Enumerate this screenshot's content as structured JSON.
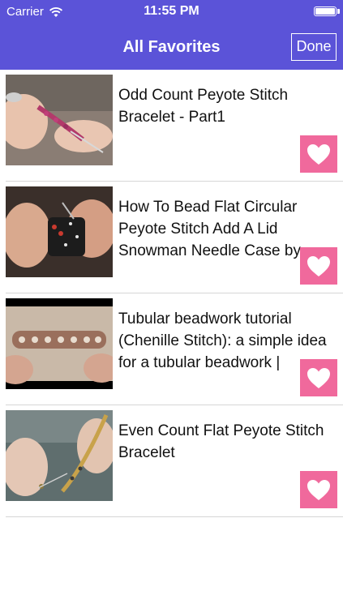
{
  "status_bar": {
    "carrier": "Carrier",
    "time": "11:55 PM"
  },
  "nav": {
    "title": "All Favorites",
    "done_label": "Done"
  },
  "items": [
    {
      "title": "Odd Count Peyote Stitch Bracelet - Part1"
    },
    {
      "title": "How To Bead Flat Circular Peyote Stitch Add A Lid Snowman Needle Case by Beth..."
    },
    {
      "title": "Tubular beadwork tutorial (Chenille Stitch): a simple idea for a tubular beadwork | Beadi..."
    },
    {
      "title": "Even Count Flat Peyote Stitch Bracelet"
    }
  ],
  "icons": {
    "favorite": "heart-icon",
    "wifi": "wifi-icon",
    "battery": "battery-icon"
  },
  "colors": {
    "nav_background": "#5b53d8",
    "favorite_button": "#f0699c"
  }
}
